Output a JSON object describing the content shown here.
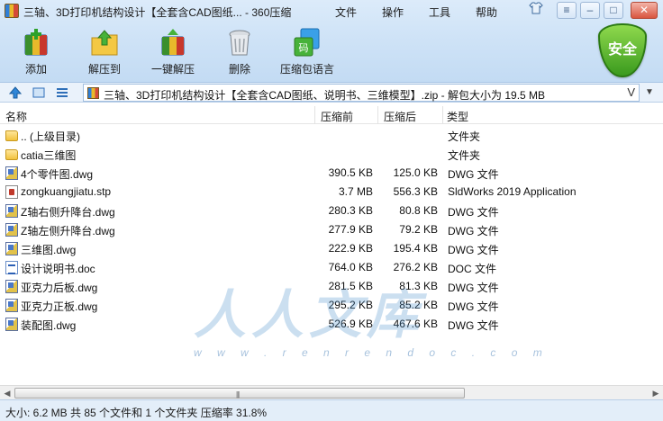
{
  "window": {
    "title": "三轴、3D打印机结构设计【全套含CAD图纸... - 360压缩",
    "controls": [
      "shirt-icon",
      "menu-icon",
      "minimize-icon",
      "maximize-icon",
      "close-icon"
    ]
  },
  "menu": {
    "file": "文件",
    "operate": "操作",
    "tools": "工具",
    "help": "帮助"
  },
  "toolbar": {
    "add": "添加",
    "extract_to": "解压到",
    "one_click_extract": "一键解压",
    "delete": "删除",
    "compress_lang": "压缩包语言",
    "safe_badge": "安全",
    "compress_lang_glyph": "码"
  },
  "address": {
    "path": "三轴、3D打印机结构设计【全套含CAD图纸、说明书、三维模型】.zip - 解包大小为 19.5 MB",
    "v_glyph": "V"
  },
  "columns": {
    "name": "名称",
    "compressed_before": "压缩前",
    "compressed_after": "压缩后",
    "type": "类型"
  },
  "files": [
    {
      "name": ".. (上级目录)",
      "before": "",
      "after": "",
      "type": "文件夹",
      "icon": "folder-icon"
    },
    {
      "name": "catia三维图",
      "before": "",
      "after": "",
      "type": "文件夹",
      "icon": "folder-icon"
    },
    {
      "name": "4个零件图.dwg",
      "before": "390.5 KB",
      "after": "125.0 KB",
      "type": "DWG 文件",
      "icon": "dwg-file-icon"
    },
    {
      "name": "zongkuangjiatu.stp",
      "before": "3.7 MB",
      "after": "556.3 KB",
      "type": "SldWorks 2019 Application",
      "icon": "stp-file-icon"
    },
    {
      "name": "Z轴右侧升降台.dwg",
      "before": "280.3 KB",
      "after": "80.8 KB",
      "type": "DWG 文件",
      "icon": "dwg-file-icon"
    },
    {
      "name": "Z轴左侧升降台.dwg",
      "before": "277.9 KB",
      "after": "79.2 KB",
      "type": "DWG 文件",
      "icon": "dwg-file-icon"
    },
    {
      "name": "三维图.dwg",
      "before": "222.9 KB",
      "after": "195.4 KB",
      "type": "DWG 文件",
      "icon": "dwg-file-icon"
    },
    {
      "name": "设计说明书.doc",
      "before": "764.0 KB",
      "after": "276.2 KB",
      "type": "DOC 文件",
      "icon": "doc-file-icon"
    },
    {
      "name": "亚克力后板.dwg",
      "before": "281.5 KB",
      "after": "81.3 KB",
      "type": "DWG 文件",
      "icon": "dwg-file-icon"
    },
    {
      "name": "亚克力正板.dwg",
      "before": "295.2 KB",
      "after": "85.2 KB",
      "type": "DWG 文件",
      "icon": "dwg-file-icon"
    },
    {
      "name": "装配图.dwg",
      "before": "526.9 KB",
      "after": "467.6 KB",
      "type": "DWG 文件",
      "icon": "dwg-file-icon"
    }
  ],
  "watermark": {
    "big": "人人文库",
    "url": "w w w . r e n r e n d o c . c o m"
  },
  "status": {
    "text": "大小: 6.2 MB 共 85 个文件和 1 个文件夹 压缩率 31.8%"
  },
  "colors": {
    "accent": "#cfe3f7",
    "shield": "#4cb02a",
    "status_bar": "#e3eef9"
  }
}
